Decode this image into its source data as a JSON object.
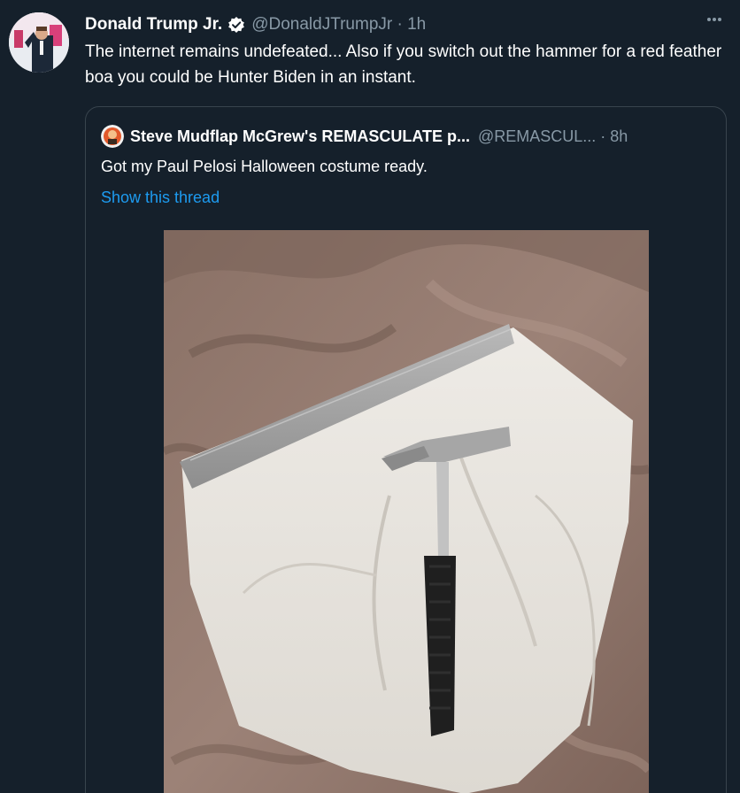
{
  "tweet": {
    "author_name": "Donald Trump Jr.",
    "author_handle": "@DonaldJTrumpJr · 1h",
    "text": "The internet remains undefeated... Also if you switch out the hammer for a red feather boa you could be Hunter Biden in an instant.",
    "more_icon": "more-horizontal-icon",
    "verified_icon": "verified-badge-icon"
  },
  "quoted_tweet": {
    "author_name": "Steve Mudflap McGrew's REMASCULATE p...",
    "author_handle": "@REMASCUL... · 8h",
    "text": "Got my Paul Pelosi Halloween costume ready.",
    "thread_link": "Show this thread"
  },
  "colors": {
    "background": "#15202b",
    "secondary_text": "#8899a6",
    "link": "#1d9bf0",
    "verified": "#1d9bf0",
    "border": "#38444d"
  }
}
